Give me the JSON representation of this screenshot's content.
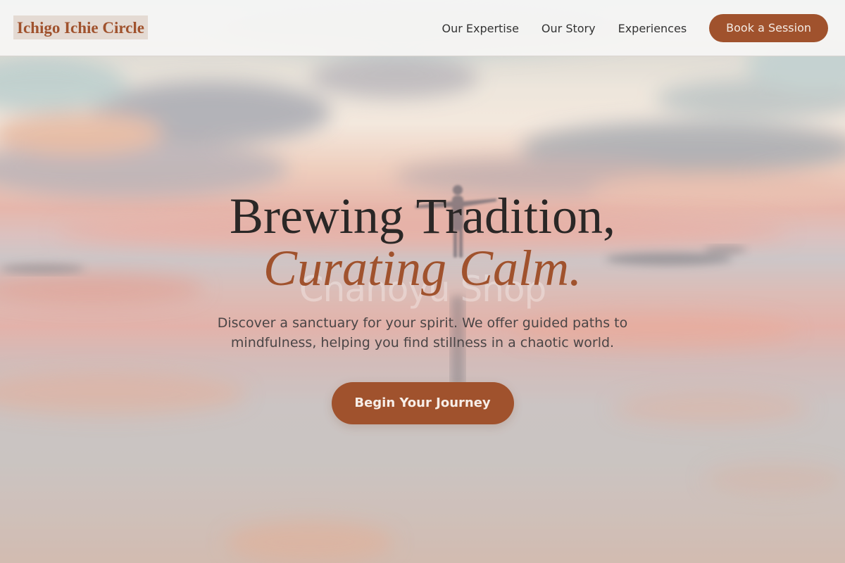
{
  "header": {
    "logo": "Ichigo Ichie Circle",
    "nav": [
      {
        "label": "Our Expertise"
      },
      {
        "label": "Our Story"
      },
      {
        "label": "Experiences"
      }
    ],
    "cta_label": "Book a Session"
  },
  "hero": {
    "headline_line1": "Brewing Tradition,",
    "headline_line2": "Curating Calm.",
    "ghost_text": "Chanoyu Shop",
    "subtext": "Discover a sanctuary for your spirit. We offer guided paths to mindfulness, helping you find stillness in a chaotic world.",
    "cta_label": "Begin Your Journey"
  },
  "colors": {
    "accent": "#a0522d",
    "headline": "#2a2726",
    "body_text": "#4a4546",
    "nav_text": "#333333"
  }
}
